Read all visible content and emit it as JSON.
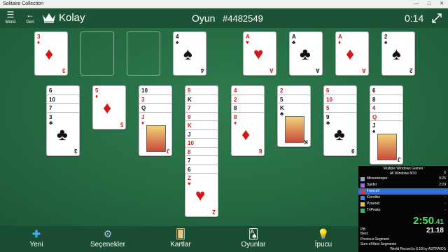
{
  "window": {
    "title": "Solitaire Collection",
    "minimize": "—",
    "maximize": "□",
    "close": "✕"
  },
  "topbar": {
    "menu_label": "Menü",
    "menu_icon": "hamburger-icon",
    "back_label": "Geri",
    "back_icon": "arrow-left-icon",
    "difficulty": "Kolay",
    "game_label": "Oyun",
    "game_id": "#4482549",
    "timer": "0:14"
  },
  "foundations": [
    {
      "rank": "A",
      "suit": "♥",
      "color": "red"
    },
    {
      "rank": "A",
      "suit": "♣",
      "color": "black"
    },
    {
      "rank": "A",
      "suit": "♦",
      "color": "red"
    },
    {
      "rank": "2",
      "suit": "♠",
      "color": "black"
    }
  ],
  "freecells": [
    {
      "rank": "3",
      "suit": "♦",
      "color": "red"
    },
    null,
    null,
    {
      "rank": "4",
      "suit": "♠",
      "color": "black"
    }
  ],
  "tableau": [
    [
      {
        "rank": "6",
        "suit": "♠"
      },
      {
        "rank": "10",
        "suit": "♠"
      },
      {
        "rank": "7",
        "suit": "♠"
      },
      {
        "rank": "3",
        "suit": "♣"
      }
    ],
    [
      {
        "rank": "5",
        "suit": "♦"
      }
    ],
    [
      {
        "rank": "10",
        "suit": "♣"
      },
      {
        "rank": "3",
        "suit": "♥"
      },
      {
        "rank": "Q",
        "suit": "♠"
      },
      {
        "rank": "J",
        "suit": "♦"
      }
    ],
    [
      {
        "rank": "9",
        "suit": "♦"
      },
      {
        "rank": "K",
        "suit": "♠"
      },
      {
        "rank": "7",
        "suit": "♦"
      },
      {
        "rank": "9",
        "suit": "♥"
      },
      {
        "rank": "K",
        "suit": "♥"
      },
      {
        "rank": "J",
        "suit": "♣"
      },
      {
        "rank": "10",
        "suit": "♥"
      },
      {
        "rank": "8",
        "suit": "♥"
      },
      {
        "rank": "7",
        "suit": "♠"
      },
      {
        "rank": "6",
        "suit": "♠"
      },
      {
        "rank": "Z",
        "suit": "♥"
      }
    ],
    [
      {
        "rank": "4",
        "suit": "♥"
      },
      {
        "rank": "2",
        "suit": "♥"
      },
      {
        "rank": "8",
        "suit": "♣"
      },
      {
        "rank": "8",
        "suit": "♦"
      }
    ],
    [
      {
        "rank": "2",
        "suit": "♦"
      },
      {
        "rank": "5",
        "suit": "♣"
      },
      {
        "rank": "K",
        "suit": "♣"
      }
    ],
    [
      {
        "rank": "6",
        "suit": "♦"
      },
      {
        "rank": "10",
        "suit": "♦"
      },
      {
        "rank": "5",
        "suit": "♥"
      },
      {
        "rank": "9",
        "suit": "♣"
      }
    ],
    [
      {
        "rank": "6",
        "suit": "♠"
      },
      {
        "rank": "8",
        "suit": "♠"
      },
      {
        "rank": "4",
        "suit": "♦"
      },
      {
        "rank": "Q",
        "suit": "♥"
      },
      {
        "rank": "J",
        "suit": "♠"
      }
    ]
  ],
  "bottombar": {
    "new_label": "Yeni",
    "new_icon": "plus-icon",
    "options_label": "Seçenekler",
    "options_icon": "gear-icon",
    "cards_label": "Kartlar",
    "cards_icon": "card-deck-icon",
    "games_label": "Oyunlar",
    "games_icon": "cards-fan-icon",
    "hint_label": "İpucu",
    "hint_icon": "lightbulb-icon"
  },
  "splits": {
    "title": "Multiple Windows Games",
    "subtitle": "All Windows 8/10",
    "attempts": "6",
    "rows": [
      {
        "name": "Minesweeper",
        "delta": "",
        "time": "0:26",
        "icon_color": "#8aa6c9"
      },
      {
        "name": "Spider",
        "delta": "",
        "time": "2:29",
        "icon_color": "#9c6bd6"
      },
      {
        "name": "Freecell",
        "delta": "",
        "time": "-",
        "icon_color": "#d23b3b",
        "active": true
      },
      {
        "name": "Klondike",
        "delta": "",
        "time": "-",
        "icon_color": "#3b8ad2"
      },
      {
        "name": "Pyramid",
        "delta": "",
        "time": "-",
        "icon_color": "#e3c240"
      },
      {
        "name": "TriPeaks",
        "delta": "",
        "time": "-",
        "icon_color": "#3bb36b"
      }
    ],
    "main_timer": "2:50",
    "main_timer_ms": ".41",
    "segment_timer": "21.18",
    "pb_label": "PB:",
    "best_label": "Best:",
    "prev_segment": "Previous Segment",
    "sum_best": "Sum of Best Segments",
    "world_record": "World Record is 6:18 by ASTRAIOS"
  },
  "colors": {
    "felt": "#256a43",
    "bar": "#1c5235",
    "accent": "#2f6fd6"
  }
}
